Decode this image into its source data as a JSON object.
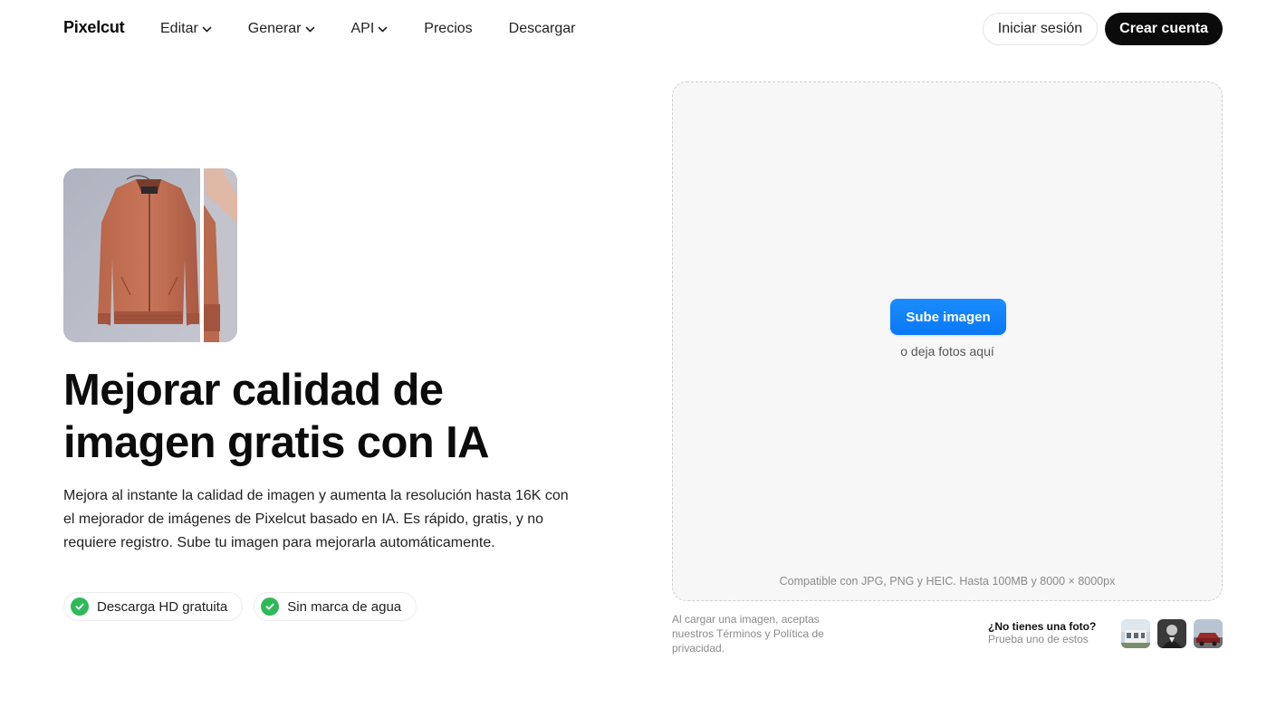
{
  "nav": {
    "logo": "Pixelcut",
    "items": [
      {
        "label": "Editar",
        "dropdown": true
      },
      {
        "label": "Generar",
        "dropdown": true
      },
      {
        "label": "API",
        "dropdown": true
      },
      {
        "label": "Precios",
        "dropdown": false
      },
      {
        "label": "Descargar",
        "dropdown": false
      }
    ],
    "login_label": "Iniciar sesión",
    "signup_label": "Crear cuenta"
  },
  "hero": {
    "image_icon": "jacket-before-after-image",
    "title_line1": "Mejorar calidad de",
    "title_line2": "imagen gratis con IA",
    "description": "Mejora al instante la calidad de imagen y aumenta la resolución hasta 16K con el mejorador de imágenes de Pixelcut basado en IA. Es rápido, gratis, y no requiere registro. Sube tu imagen para mejorarla automáticamente.",
    "badges": [
      {
        "label": "Descarga HD gratuita",
        "icon": "check-circle-icon"
      },
      {
        "label": "Sin marca de agua",
        "icon": "check-circle-icon"
      }
    ]
  },
  "upload": {
    "button_label": "Sube imagen",
    "drop_hint": "o deja fotos aquí",
    "compat": "Compatible con JPG, PNG y HEIC. Hasta 100MB y 8000 × 8000px",
    "terms": "Al cargar una imagen, aceptas nuestros Términos y Política de privacidad.",
    "no_photo_title": "¿No tienes una foto?",
    "no_photo_sub": "Prueba uno de estos",
    "samples": [
      "sample-house-image",
      "sample-portrait-image",
      "sample-car-image"
    ]
  },
  "colors": {
    "accent": "#0a78f5",
    "dark_button": "#0b0b0b",
    "check_green": "#2fb95a",
    "dropzone_bg": "#f7f7f7"
  }
}
